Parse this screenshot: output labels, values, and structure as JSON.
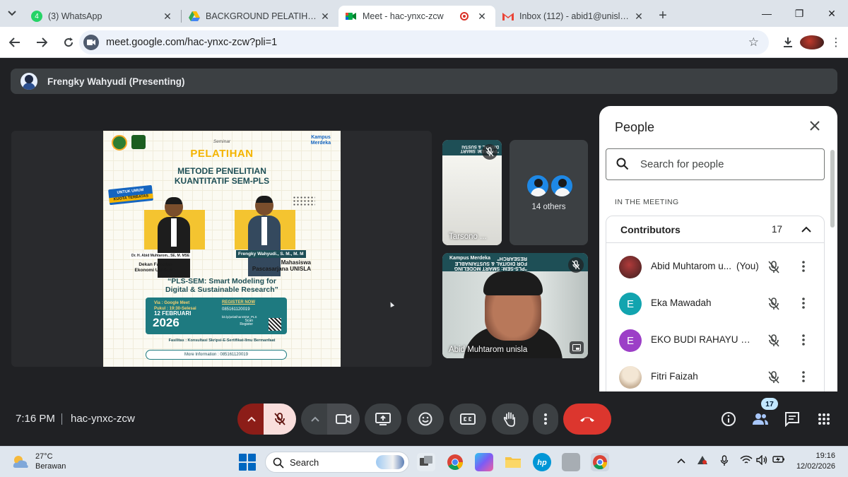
{
  "browser": {
    "tabs": [
      {
        "label": "(3) WhatsApp",
        "favicon_color": "#25d366",
        "favicon_text": "4"
      },
      {
        "label": "BACKGROUND PELATIHAN - Go",
        "favicon_color": "#fbbc04"
      },
      {
        "label": "Meet - hac-ynxc-zcw",
        "favicon_color": "#00897b"
      },
      {
        "label": "Inbox (112) - abid1@unisla.ac.id",
        "favicon_color": "#ea4335"
      }
    ],
    "url": "meet.google.com/hac-ynxc-zcw?pli=1"
  },
  "presenter": {
    "banner": "Frengky Wahyudi (Presenting)"
  },
  "poster": {
    "seminar": "Seminar",
    "heading": "PELATIHAN",
    "title_line1": "METODE PENELITIAN",
    "title_line2": "KUANTITATIF SEM-PLS",
    "badge_top": "UNTUK UMUM",
    "badge_bottom": "KUOTA TERBATAS",
    "kampus": "Kampus Merdeka",
    "speaker1_name": "Dr. H. Abid Muhtarom., SE, M. MSE",
    "speaker1_role": "Dekan Fakultas Ekonomi UNISLA",
    "speaker2_name": "Frengky Wahyudi., S. M., M. M",
    "speaker2_role": "Mahasiswa Pascasarjana UNISLA",
    "quote_line1": "“PLS-SEM: Smart Modeling for",
    "quote_line2": "Digital & Sustainable Research”",
    "via": "Via : Google Meet",
    "pukul": "Pukul : 19:30-Selesai",
    "date": "12 FEBRUARI",
    "year": "2026",
    "register": "REGISTER NOW",
    "phone": "085161120019",
    "bitly": "bit.ly/pelatihanSEM_PLS",
    "scan": "Scan Register",
    "fasilitas": "Fasilitas : Konsultasi Skripsi-E-Sertifikat-Ilmu Bermanfaat",
    "more_info": "More Information : 085161120019"
  },
  "tiles": {
    "tile1_name": "Tarsono ...",
    "tile1_banner": "\"PLS-SEM: SMART DIGITAL & SUSTAI",
    "others_label": "14 others",
    "tile3_name": "Abid Muhtarom unisla",
    "tile3_banner": "\"PLS-SEM: SMART MODELING FOR DIGITAL & SUSTAINABLE RESEARCH\"",
    "tile3_logo": "Kampus Merdeka"
  },
  "people_panel": {
    "title": "People",
    "search_placeholder": "Search for people",
    "section_label": "IN THE MEETING",
    "group_label": "Contributors",
    "group_count": "17",
    "participants": [
      {
        "name": "Abid Muhtarom u...",
        "suffix": "(You)",
        "avatar_color": "#6d2b2b",
        "initial": ""
      },
      {
        "name": "Eka Mawadah",
        "suffix": "",
        "avatar_color": "#12a4af",
        "initial": "E"
      },
      {
        "name": "EKO BUDI RAHAYU MUL...",
        "suffix": "",
        "avatar_color": "#9c3fc7",
        "initial": "E"
      },
      {
        "name": "Fitri Faizah",
        "suffix": "",
        "avatar_color": "#e9dccb",
        "initial": ""
      }
    ]
  },
  "controls": {
    "time": "7:16 PM",
    "meeting_code": "hac-ynxc-zcw",
    "people_badge": "17"
  },
  "taskbar": {
    "temp": "27°C",
    "weather": "Berawan",
    "search": "Search",
    "time": "19:16",
    "date": "12/02/2026"
  }
}
